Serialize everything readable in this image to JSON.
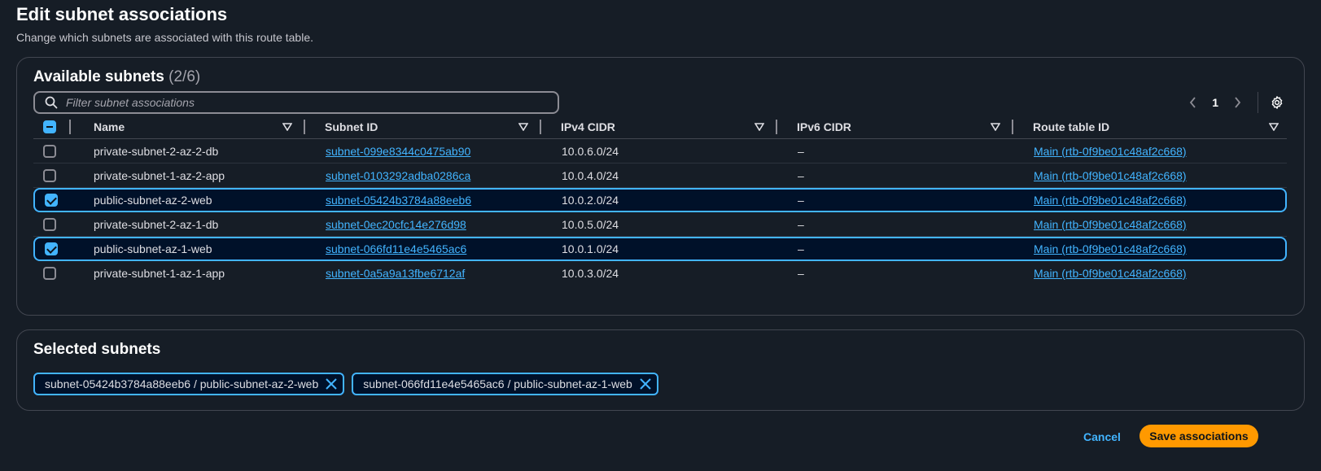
{
  "page": {
    "title": "Edit subnet associations",
    "description": "Change which subnets are associated with this route table."
  },
  "available": {
    "title": "Available subnets",
    "count": "(2/6)",
    "filter_placeholder": "Filter subnet associations",
    "page_number": "1",
    "columns": [
      "Name",
      "Subnet ID",
      "IPv4 CIDR",
      "IPv6 CIDR",
      "Route table ID"
    ],
    "rows": [
      {
        "name": "private-subnet-2-az-2-db",
        "subnet_id": "subnet-099e8344c0475ab90",
        "ipv4": "10.0.6.0/24",
        "ipv6": "–",
        "route_table": "Main (rtb-0f9be01c48af2c668)",
        "selected": false
      },
      {
        "name": "private-subnet-1-az-2-app",
        "subnet_id": "subnet-0103292adba0286ca",
        "ipv4": "10.0.4.0/24",
        "ipv6": "–",
        "route_table": "Main (rtb-0f9be01c48af2c668)",
        "selected": false
      },
      {
        "name": "public-subnet-az-2-web",
        "subnet_id": "subnet-05424b3784a88eeb6",
        "ipv4": "10.0.2.0/24",
        "ipv6": "–",
        "route_table": "Main (rtb-0f9be01c48af2c668)",
        "selected": true
      },
      {
        "name": "private-subnet-2-az-1-db",
        "subnet_id": "subnet-0ec20cfc14e276d98",
        "ipv4": "10.0.5.0/24",
        "ipv6": "–",
        "route_table": "Main (rtb-0f9be01c48af2c668)",
        "selected": false
      },
      {
        "name": "public-subnet-az-1-web",
        "subnet_id": "subnet-066fd11e4e5465ac6",
        "ipv4": "10.0.1.0/24",
        "ipv6": "–",
        "route_table": "Main (rtb-0f9be01c48af2c668)",
        "selected": true
      },
      {
        "name": "private-subnet-1-az-1-app",
        "subnet_id": "subnet-0a5a9a13fbe6712af",
        "ipv4": "10.0.3.0/24",
        "ipv6": "–",
        "route_table": "Main (rtb-0f9be01c48af2c668)",
        "selected": false
      }
    ]
  },
  "selected": {
    "title": "Selected subnets",
    "tokens": [
      "subnet-05424b3784a88eeb6 / public-subnet-az-2-web",
      "subnet-066fd11e4e5465ac6 / public-subnet-az-1-web"
    ]
  },
  "footer": {
    "cancel_label": "Cancel",
    "save_label": "Save associations"
  },
  "colors": {
    "background": "#161d26",
    "accent": "#42b4ff",
    "primary_button": "#ff9900",
    "selected_row": "#001129"
  },
  "icons": [
    "search-icon",
    "chevron-left-icon",
    "chevron-right-icon",
    "gear-icon",
    "sort-down-icon",
    "close-icon"
  ]
}
